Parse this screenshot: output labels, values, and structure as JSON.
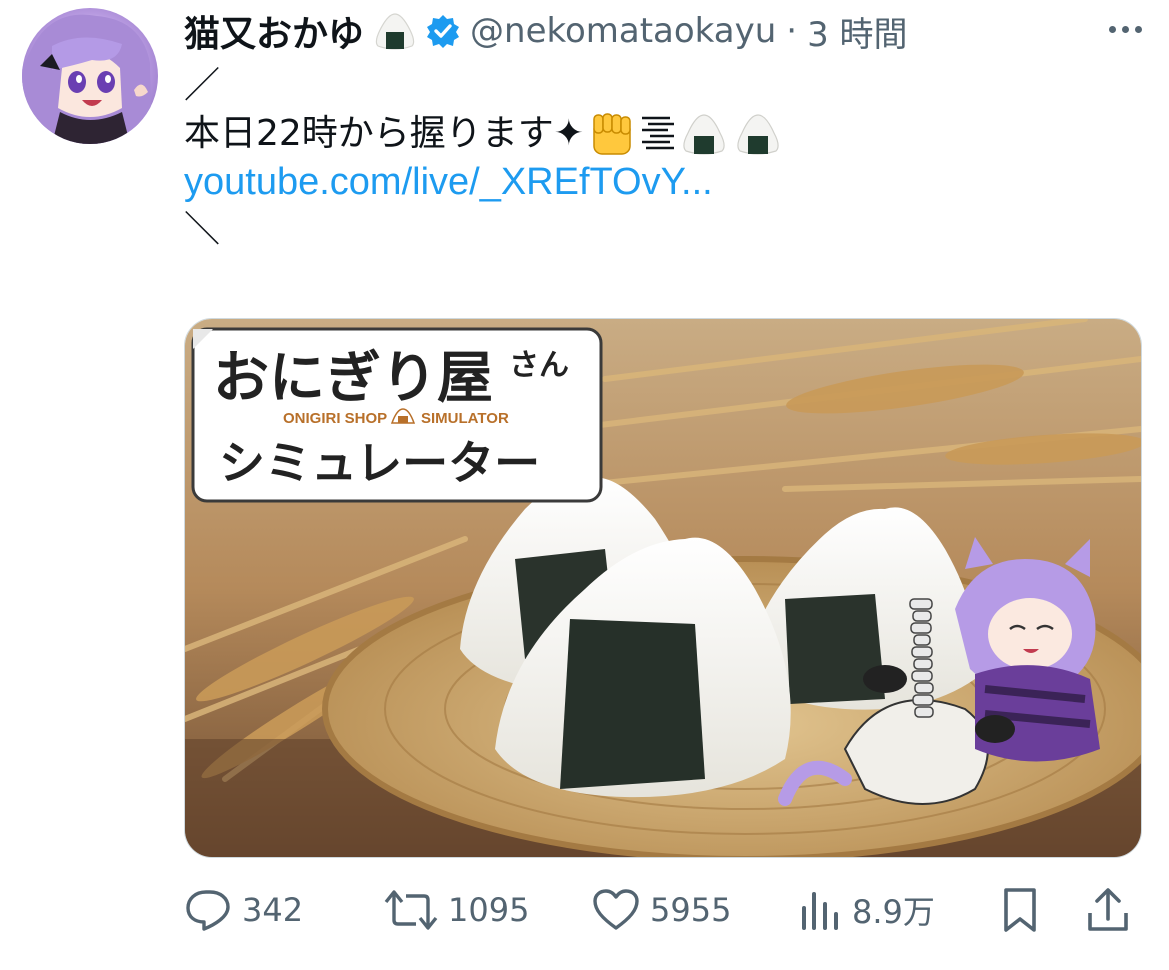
{
  "author": {
    "display_name": "猫又おかゆ",
    "handle": "@nekomataokayu",
    "separator": "·",
    "time": "3 時間"
  },
  "tweet": {
    "line1": "／",
    "line2": "本日22時から握ります✦",
    "link": "youtube.com/live/_XREfTOvY...",
    "line4": "＼"
  },
  "media": {
    "title_main": "おにぎり屋",
    "title_san": "さん",
    "subtitle_left": "ONIGIRI SHOP",
    "subtitle_right": "SIMULATOR",
    "title_line2": "シミュレーター"
  },
  "actions": {
    "replies": "342",
    "retweets": "1095",
    "likes": "5955",
    "views": "8.9万"
  },
  "colors": {
    "link": "#1d9bf0",
    "verified": "#1d9bf0",
    "muted": "#536471"
  },
  "icons": [
    "onigiri-icon",
    "verified-badge-icon",
    "more-icon",
    "fist-emoji",
    "speed-lines-emoji",
    "reply-icon",
    "retweet-icon",
    "like-icon",
    "views-icon",
    "bookmark-icon",
    "share-icon"
  ]
}
